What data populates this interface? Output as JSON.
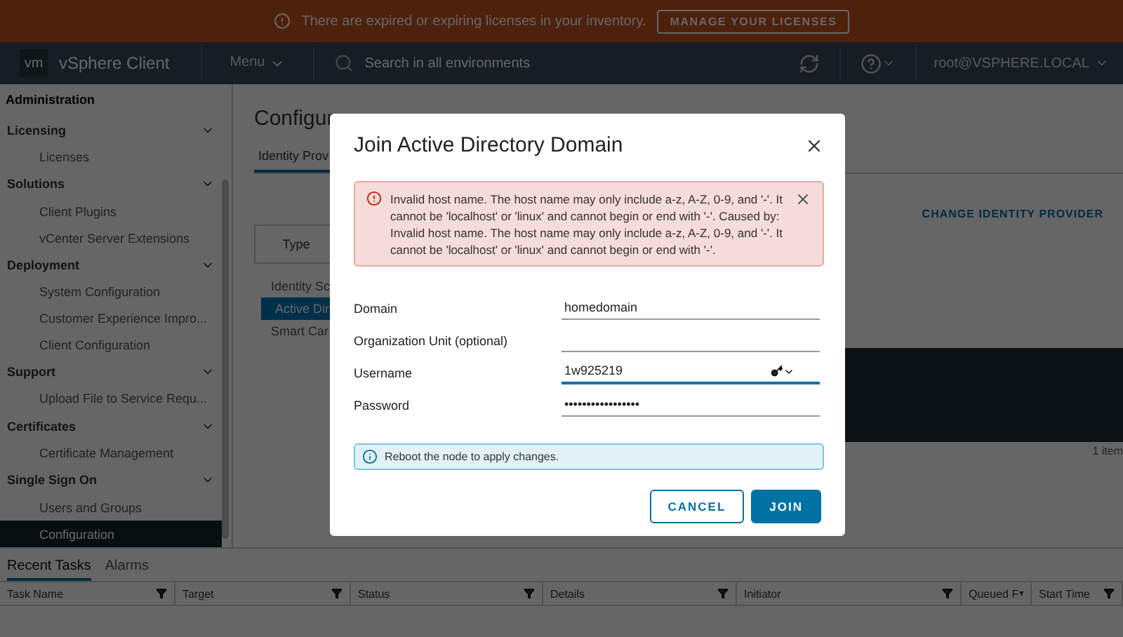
{
  "banner": {
    "message": "There are expired or expiring licenses in your inventory.",
    "action": "MANAGE YOUR LICENSES"
  },
  "header": {
    "logo": "vm",
    "product": "vSphere Client",
    "menu": "Menu",
    "search": {
      "placeholder": "Search in all environments"
    },
    "user": "root@VSPHERE.LOCAL"
  },
  "sidebar": {
    "title": "Administration",
    "sections": [
      {
        "label": "Licensing",
        "expanded": true,
        "items": [
          {
            "label": "Licenses",
            "selected": false
          }
        ]
      },
      {
        "label": "Solutions",
        "expanded": true,
        "items": [
          {
            "label": "Client Plugins",
            "selected": false
          },
          {
            "label": "vCenter Server Extensions",
            "selected": false
          }
        ]
      },
      {
        "label": "Deployment",
        "expanded": true,
        "items": [
          {
            "label": "System Configuration",
            "selected": false
          },
          {
            "label": "Customer Experience Impro...",
            "selected": false
          },
          {
            "label": "Client Configuration",
            "selected": false
          }
        ]
      },
      {
        "label": "Support",
        "expanded": true,
        "items": [
          {
            "label": "Upload File to Service Requ...",
            "selected": false
          }
        ]
      },
      {
        "label": "Certificates",
        "expanded": true,
        "items": [
          {
            "label": "Certificate Management",
            "selected": false
          }
        ]
      },
      {
        "label": "Single Sign On",
        "expanded": true,
        "items": [
          {
            "label": "Users and Groups",
            "selected": false
          },
          {
            "label": "Configuration",
            "selected": true
          }
        ]
      }
    ]
  },
  "main": {
    "title": "Configur",
    "tabs": [
      {
        "label": "Identity Prov",
        "selected": true
      }
    ],
    "type_header": "Type",
    "sources": [
      {
        "label": "Identity Sc",
        "selected": false
      },
      {
        "label": "Active Dir",
        "selected": true
      },
      {
        "label": "Smart Car",
        "selected": false
      }
    ],
    "change_link": "CHANGE IDENTITY PROVIDER",
    "count": "1 item"
  },
  "dialog": {
    "title": "Join Active Directory Domain",
    "error": "Invalid host name. The host name may only include a-z, A-Z, 0-9, and '-'. It cannot be 'localhost' or 'linux' and cannot begin or end with '-'. Caused by: Invalid host name. The host name may only include a-z, A-Z, 0-9, and '-'. It cannot be 'localhost' or 'linux' and cannot begin or end with '-'.",
    "fields": [
      {
        "label": "Domain",
        "value": "homedomain",
        "kind": "text",
        "focused": false
      },
      {
        "label": "Organization Unit (optional)",
        "kind": "text",
        "focused": false
      },
      {
        "label": "Username",
        "value": "1w925219",
        "kind": "user",
        "focused": true
      },
      {
        "label": "Password",
        "value": "•••••••••••••••••",
        "kind": "text",
        "focused": false
      }
    ],
    "info": "Reboot the node to apply changes.",
    "buttons": [
      {
        "label": "CANCEL",
        "kind": "outline"
      },
      {
        "label": "JOIN",
        "kind": "primary"
      }
    ]
  },
  "bottom": {
    "tabs": [
      {
        "label": "Recent Tasks",
        "selected": true
      },
      {
        "label": "Alarms",
        "selected": false
      }
    ],
    "columns": [
      {
        "label": "Task Name"
      },
      {
        "label": "Target"
      },
      {
        "label": "Status"
      },
      {
        "label": "Details"
      },
      {
        "label": "Initiator"
      },
      {
        "label": "Queued F"
      },
      {
        "label": "Start Time"
      }
    ]
  }
}
